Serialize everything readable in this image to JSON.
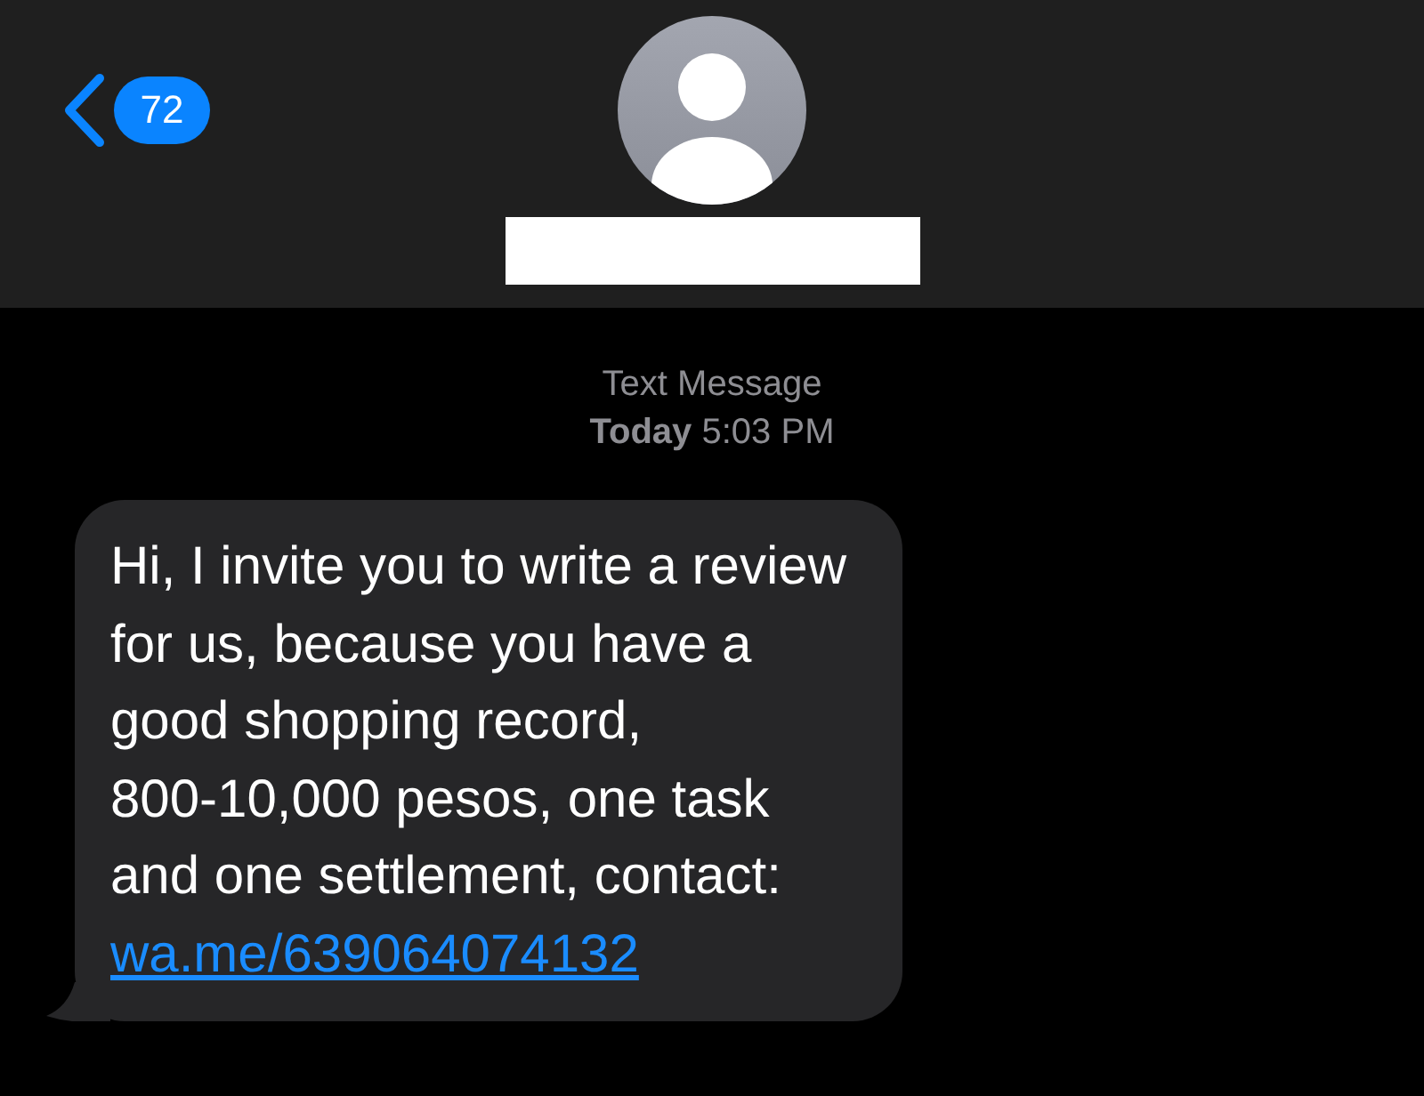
{
  "header": {
    "back_count": "72",
    "name_redacted": true
  },
  "conversation": {
    "service": "Text Message",
    "timestamp_day": "Today",
    "timestamp_time": "5:03 PM"
  },
  "message": {
    "lines": [
      "Hi, I invite you to write a review",
      "for us, because you have a",
      "good shopping record,",
      "800-10,000 pesos, one task",
      "and one settlement, contact:"
    ],
    "link": "wa.me/639064074132"
  }
}
